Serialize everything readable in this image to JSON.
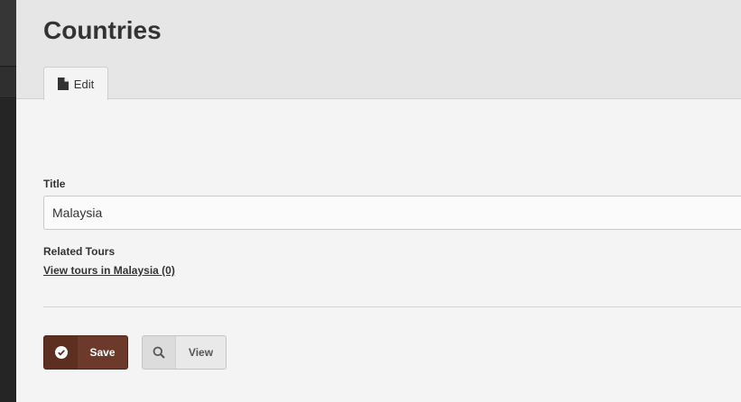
{
  "header": {
    "page_title": "Countries",
    "tabs": [
      {
        "label": "Edit",
        "icon": "document-icon",
        "active": true
      }
    ]
  },
  "form": {
    "title_label": "Title",
    "title_value": "Malaysia",
    "related_label": "Related Tours",
    "related_link": "View tours in Malaysia (0)"
  },
  "actions": {
    "save_label": "Save",
    "save_icon": "check-circle-icon",
    "view_label": "View",
    "view_icon": "magnifier-icon"
  },
  "colors": {
    "save_button": "#6b3a2a",
    "header_bg": "#e6e6e6",
    "content_bg": "#f4f4f4",
    "left_bar": "#2b2b2b"
  }
}
